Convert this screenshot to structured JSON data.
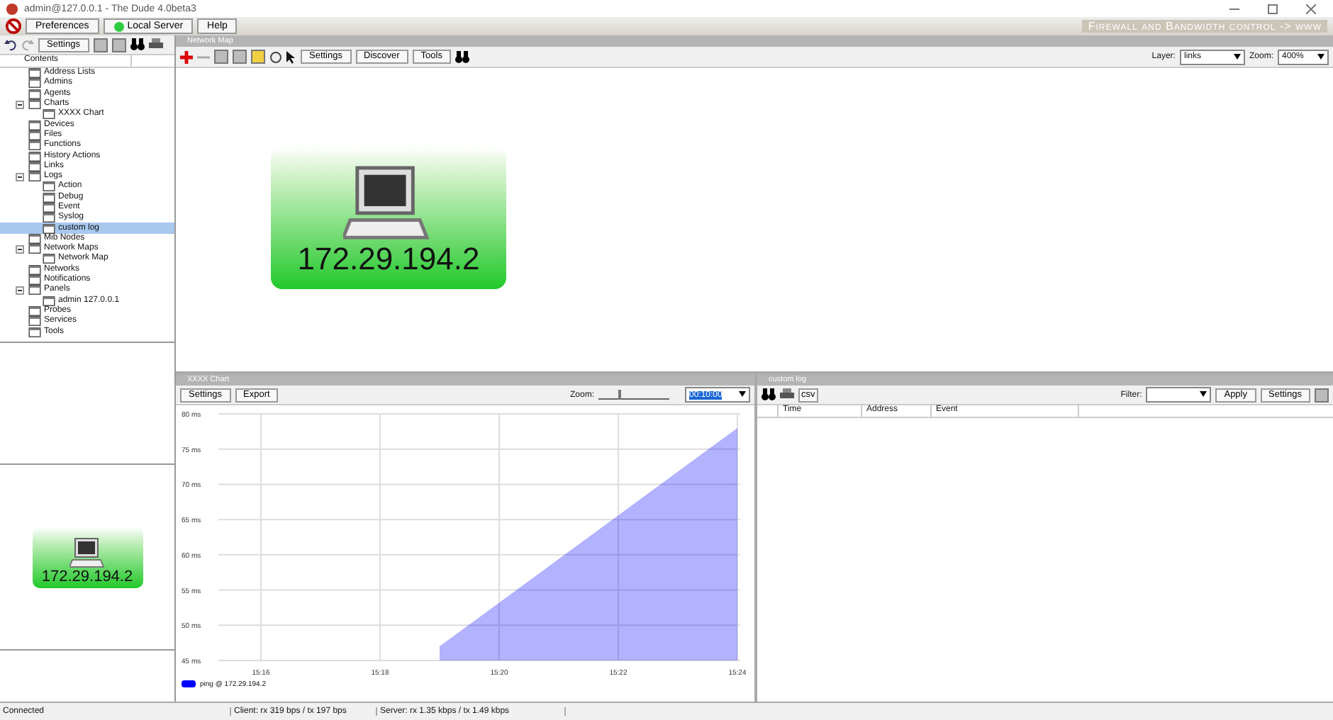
{
  "window": {
    "title": "admin@127.0.0.1 - The Dude 4.0beta3"
  },
  "menu": [
    "Preferences",
    "Local Server",
    "Help"
  ],
  "banner": "Firewall and Bandwidth control -> www",
  "left_toolbar": {
    "settings": "Settings"
  },
  "tree": {
    "header": "Contents",
    "items": [
      {
        "label": "Address Lists",
        "selected": false
      },
      {
        "label": "Admins",
        "selected": false
      },
      {
        "label": "Agents",
        "selected": false
      },
      {
        "label": "Charts",
        "selected": false,
        "expanded": true,
        "children": [
          {
            "label": "XXXX Chart",
            "selected": false
          }
        ]
      },
      {
        "label": "Devices",
        "selected": false
      },
      {
        "label": "Files",
        "selected": false
      },
      {
        "label": "Functions",
        "selected": false
      },
      {
        "label": "History Actions",
        "selected": false
      },
      {
        "label": "Links",
        "selected": false
      },
      {
        "label": "Logs",
        "selected": false,
        "expanded": true,
        "children": [
          {
            "label": "Action",
            "selected": false
          },
          {
            "label": "Debug",
            "selected": false
          },
          {
            "label": "Event",
            "selected": false
          },
          {
            "label": "Syslog",
            "selected": false
          },
          {
            "label": "custom log",
            "selected": true
          }
        ]
      },
      {
        "label": "Mib Nodes",
        "selected": false
      },
      {
        "label": "Network Maps",
        "selected": false,
        "expanded": true,
        "children": [
          {
            "label": "Network Map",
            "selected": false
          }
        ]
      },
      {
        "label": "Networks",
        "selected": false
      },
      {
        "label": "Notifications",
        "selected": false
      },
      {
        "label": "Panels",
        "selected": false,
        "expanded": true,
        "children": [
          {
            "label": "admin 127.0.0.1",
            "selected": false
          }
        ]
      },
      {
        "label": "Probes",
        "selected": false
      },
      {
        "label": "Services",
        "selected": false
      },
      {
        "label": "Tools",
        "selected": false
      }
    ]
  },
  "preview": {
    "device_label": "172.29.194.2"
  },
  "network_map": {
    "title": "Network Map",
    "buttons": [
      "Settings",
      "Discover",
      "Tools"
    ],
    "layer_label": "Layer:",
    "layer": "links",
    "zoom_label": "Zoom:",
    "zoom": "400%",
    "device": {
      "label": "172.29.194.2"
    }
  },
  "chart_panel": {
    "title": "XXXX Chart",
    "settings": "Settings",
    "export": "Export",
    "zoom_label": "Zoom:",
    "zoom": "00:10:00",
    "zoom_slider": {
      "level": 0.3
    },
    "chart_data": {
      "type": "area",
      "categories": [
        "15:16",
        null,
        "15:18",
        null,
        "15:20",
        null,
        "15:22",
        null,
        "15:24"
      ],
      "series": [
        {
          "name": "ping @ 172.29.194.2",
          "color": "#0000ff",
          "values": [
            null,
            null,
            null,
            47,
            53.2,
            59.4,
            65.6,
            71.8,
            78
          ]
        }
      ],
      "ylim": [
        45,
        80
      ],
      "grid": true,
      "yticks": [
        {
          "value": 80,
          "label": "80 ms"
        },
        {
          "value": 75,
          "label": "75 ms"
        },
        {
          "value": 70,
          "label": "70 ms"
        },
        {
          "value": 65,
          "label": "65 ms"
        },
        {
          "value": 60,
          "label": "60 ms"
        },
        {
          "value": 55,
          "label": "55 ms"
        },
        {
          "value": 50,
          "label": "50 ms"
        },
        {
          "value": 45,
          "label": "45 ms"
        }
      ]
    }
  },
  "log_panel": {
    "title": "custom log",
    "csv": "csv",
    "filter_label": "Filter:",
    "apply": "Apply",
    "settings": "Settings",
    "columns": [
      "Time",
      "Address",
      "Event"
    ]
  },
  "status_bar": [
    "Connected",
    "Client: rx 319 bps / tx 197 bps",
    "Server: rx 1.35 kbps / tx 1.49 kbps"
  ]
}
